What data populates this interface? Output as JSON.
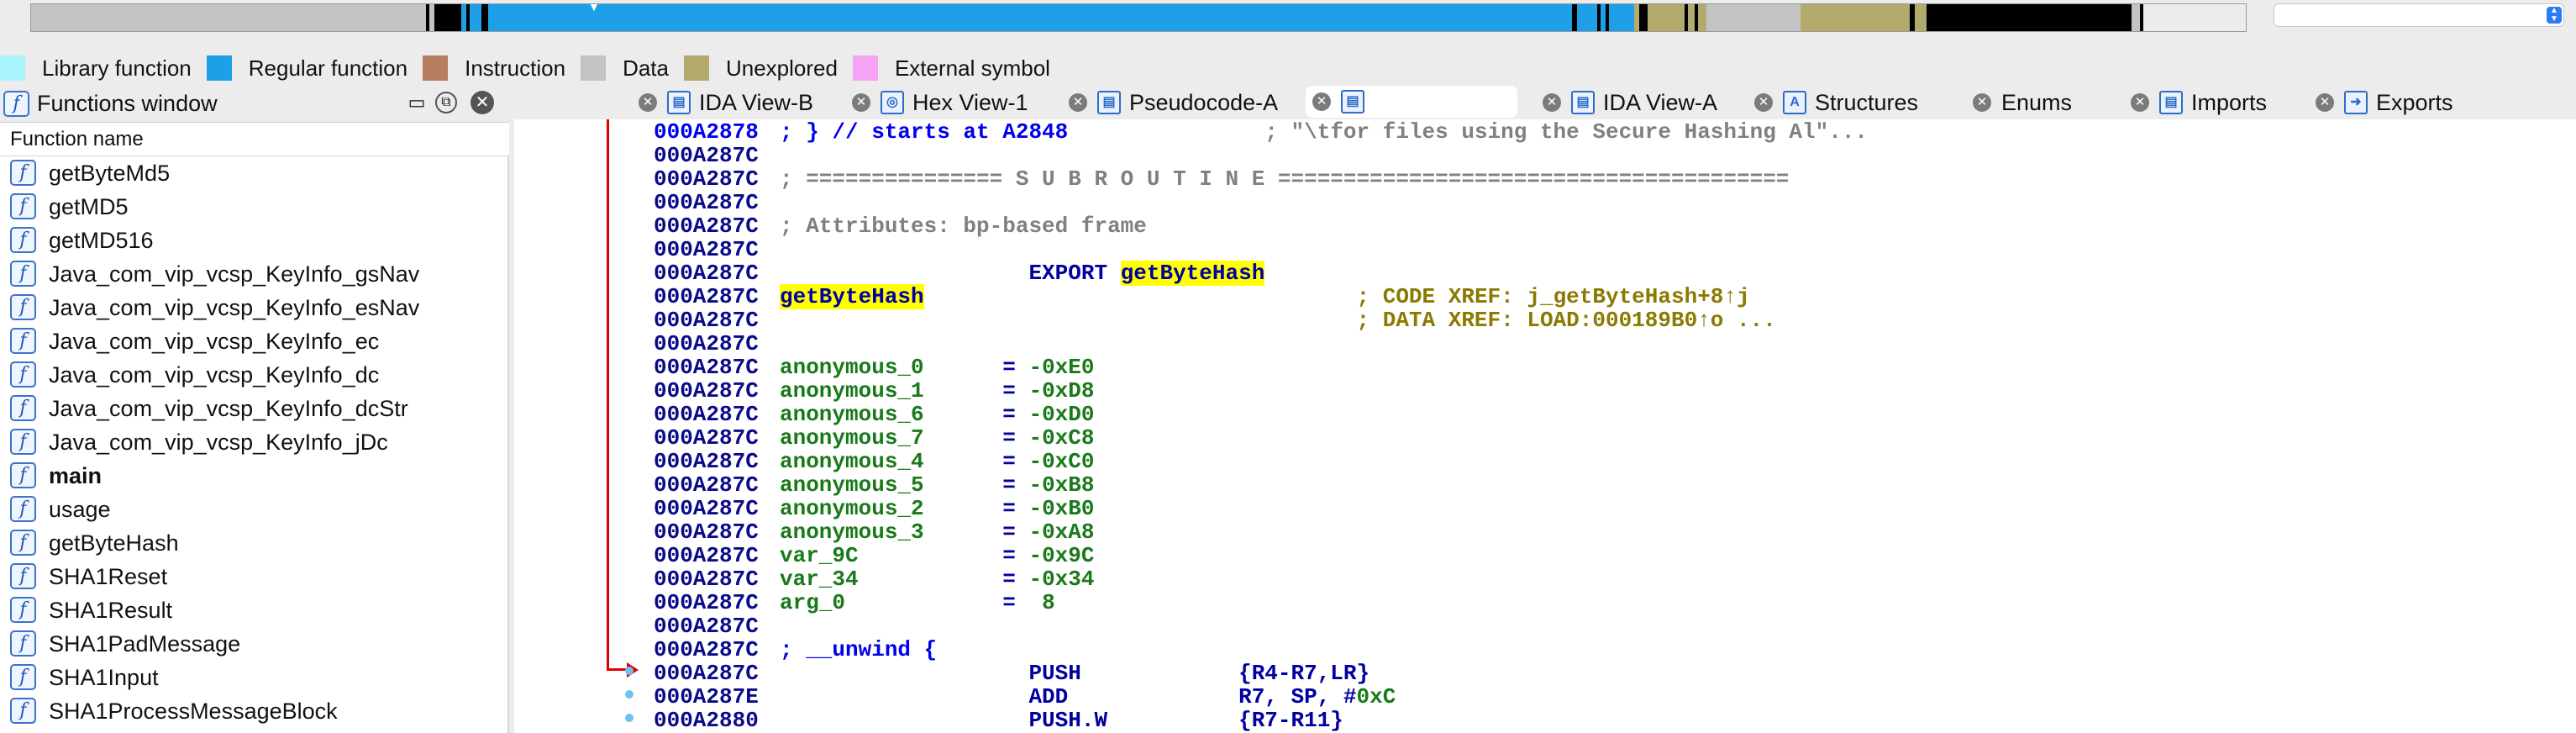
{
  "colors": {
    "library": "#a9f5fb",
    "regular": "#1ea0e8",
    "instruction": "#b67d5e",
    "data": "#c3c3c3",
    "unexplored": "#b2ab6c",
    "external": "#f7a4f5",
    "accent": "#2a7df5"
  },
  "legend": [
    {
      "label": "Library function",
      "color": "#a9f5fb"
    },
    {
      "label": "Regular function",
      "color": "#1ea0e8"
    },
    {
      "label": "Instruction",
      "color": "#b67d5e"
    },
    {
      "label": "Data",
      "color": "#c3c3c3"
    },
    {
      "label": "Unexplored",
      "color": "#b2ab6c"
    },
    {
      "label": "External symbol",
      "color": "#f7a4f5"
    }
  ],
  "functions_window": {
    "title": "Functions window",
    "column_header": "Function name",
    "items": [
      {
        "name": "getByteMd5",
        "bold": false
      },
      {
        "name": "getMD5",
        "bold": false
      },
      {
        "name": "getMD516",
        "bold": false
      },
      {
        "name": "Java_com_vip_vcsp_KeyInfo_gsNav",
        "bold": false
      },
      {
        "name": "Java_com_vip_vcsp_KeyInfo_esNav",
        "bold": false
      },
      {
        "name": "Java_com_vip_vcsp_KeyInfo_ec",
        "bold": false
      },
      {
        "name": "Java_com_vip_vcsp_KeyInfo_dc",
        "bold": false
      },
      {
        "name": "Java_com_vip_vcsp_KeyInfo_dcStr",
        "bold": false
      },
      {
        "name": "Java_com_vip_vcsp_KeyInfo_jDc",
        "bold": false
      },
      {
        "name": "main",
        "bold": true
      },
      {
        "name": "usage",
        "bold": false
      },
      {
        "name": "getByteHash",
        "bold": false
      },
      {
        "name": "SHA1Reset",
        "bold": false
      },
      {
        "name": "SHA1Result",
        "bold": false
      },
      {
        "name": "SHA1PadMessage",
        "bold": false
      },
      {
        "name": "SHA1Input",
        "bold": false
      },
      {
        "name": "SHA1ProcessMessageBlock",
        "bold": false
      }
    ]
  },
  "tabs": [
    {
      "label": "IDA View-B",
      "icon": "ida-view-icon",
      "active": false
    },
    {
      "label": "Hex View-1",
      "icon": "hex-view-icon",
      "active": false
    },
    {
      "label": "Pseudocode-A",
      "icon": "pseudocode-icon",
      "active": false
    },
    {
      "label": "",
      "icon": "ida-view-icon",
      "active": true
    },
    {
      "label": "IDA View-A",
      "icon": "ida-view-icon",
      "active": false
    },
    {
      "label": "Structures",
      "icon": "structures-icon",
      "active": false
    },
    {
      "label": "Enums",
      "icon": "enums-icon",
      "active": false
    },
    {
      "label": "Imports",
      "icon": "imports-icon",
      "active": false
    },
    {
      "label": "Exports",
      "icon": "exports-icon",
      "active": false
    }
  ],
  "disasm": {
    "lines": [
      {
        "addr": "000A2878",
        "parts": [
          {
            "t": "; } // starts at A2848",
            "c": "c-blue"
          },
          {
            "t": "               ; \"\\tfor files using the Secure Hashing Al\"...",
            "c": "c-com"
          }
        ]
      },
      {
        "addr": "000A287C",
        "parts": []
      },
      {
        "addr": "000A287C",
        "parts": [
          {
            "t": "; =============== S U B R O U T I N E =======================================",
            "c": "c-com"
          }
        ]
      },
      {
        "addr": "000A287C",
        "parts": []
      },
      {
        "addr": "000A287C",
        "parts": [
          {
            "t": "; Attributes: bp-based frame",
            "c": "c-com"
          }
        ]
      },
      {
        "addr": "000A287C",
        "parts": []
      },
      {
        "addr": "000A287C",
        "parts": [
          {
            "t": "                   EXPORT ",
            "c": "c-ins"
          },
          {
            "t": "getByteHash",
            "c": "hl"
          }
        ]
      },
      {
        "addr": "000A287C",
        "parts": [
          {
            "t": "getByteHash",
            "c": "hl"
          },
          {
            "t": "                                 ; CODE XREF: j_getByteHash+8↑j",
            "c": "c-olive"
          }
        ]
      },
      {
        "addr": "000A287C",
        "parts": [
          {
            "t": "                                            ; DATA XREF: LOAD:000189B0↑o ...",
            "c": "c-olive"
          }
        ]
      },
      {
        "addr": "000A287C",
        "parts": []
      },
      {
        "addr": "000A287C",
        "parts": [
          {
            "t": "anonymous_0",
            "c": "c-green"
          },
          {
            "t": "      = ",
            "c": "c-name"
          },
          {
            "t": "-0xE0",
            "c": "c-green"
          }
        ]
      },
      {
        "addr": "000A287C",
        "parts": [
          {
            "t": "anonymous_1",
            "c": "c-green"
          },
          {
            "t": "      = ",
            "c": "c-name"
          },
          {
            "t": "-0xD8",
            "c": "c-green"
          }
        ]
      },
      {
        "addr": "000A287C",
        "parts": [
          {
            "t": "anonymous_6",
            "c": "c-green"
          },
          {
            "t": "      = ",
            "c": "c-name"
          },
          {
            "t": "-0xD0",
            "c": "c-green"
          }
        ]
      },
      {
        "addr": "000A287C",
        "parts": [
          {
            "t": "anonymous_7",
            "c": "c-green"
          },
          {
            "t": "      = ",
            "c": "c-name"
          },
          {
            "t": "-0xC8",
            "c": "c-green"
          }
        ]
      },
      {
        "addr": "000A287C",
        "parts": [
          {
            "t": "anonymous_4",
            "c": "c-green"
          },
          {
            "t": "      = ",
            "c": "c-name"
          },
          {
            "t": "-0xC0",
            "c": "c-green"
          }
        ]
      },
      {
        "addr": "000A287C",
        "parts": [
          {
            "t": "anonymous_5",
            "c": "c-green"
          },
          {
            "t": "      = ",
            "c": "c-name"
          },
          {
            "t": "-0xB8",
            "c": "c-green"
          }
        ]
      },
      {
        "addr": "000A287C",
        "parts": [
          {
            "t": "anonymous_2",
            "c": "c-green"
          },
          {
            "t": "      = ",
            "c": "c-name"
          },
          {
            "t": "-0xB0",
            "c": "c-green"
          }
        ]
      },
      {
        "addr": "000A287C",
        "parts": [
          {
            "t": "anonymous_3",
            "c": "c-green"
          },
          {
            "t": "      = ",
            "c": "c-name"
          },
          {
            "t": "-0xA8",
            "c": "c-green"
          }
        ]
      },
      {
        "addr": "000A287C",
        "parts": [
          {
            "t": "var_9C",
            "c": "c-green"
          },
          {
            "t": "           = ",
            "c": "c-name"
          },
          {
            "t": "-0x9C",
            "c": "c-green"
          }
        ]
      },
      {
        "addr": "000A287C",
        "parts": [
          {
            "t": "var_34",
            "c": "c-green"
          },
          {
            "t": "           = ",
            "c": "c-name"
          },
          {
            "t": "-0x34",
            "c": "c-green"
          }
        ]
      },
      {
        "addr": "000A287C",
        "parts": [
          {
            "t": "arg_0",
            "c": "c-green"
          },
          {
            "t": "            =  ",
            "c": "c-name"
          },
          {
            "t": "8",
            "c": "c-green"
          }
        ]
      },
      {
        "addr": "000A287C",
        "parts": []
      },
      {
        "addr": "000A287C",
        "parts": [
          {
            "t": "; __unwind {",
            "c": "c-blue"
          }
        ]
      },
      {
        "addr": "000A287C",
        "parts": [
          {
            "t": "                   PUSH            ",
            "c": "c-ins"
          },
          {
            "t": "{R4-R7,LR}",
            "c": "c-op"
          }
        ]
      },
      {
        "addr": "000A287E",
        "parts": [
          {
            "t": "                   ADD             ",
            "c": "c-ins"
          },
          {
            "t": "R7, SP, #",
            "c": "c-op"
          },
          {
            "t": "0xC",
            "c": "c-green"
          }
        ]
      },
      {
        "addr": "000A2880",
        "parts": [
          {
            "t": "                   PUSH.W          ",
            "c": "c-ins"
          },
          {
            "t": "{R7-R11}",
            "c": "c-op"
          }
        ]
      }
    ]
  }
}
